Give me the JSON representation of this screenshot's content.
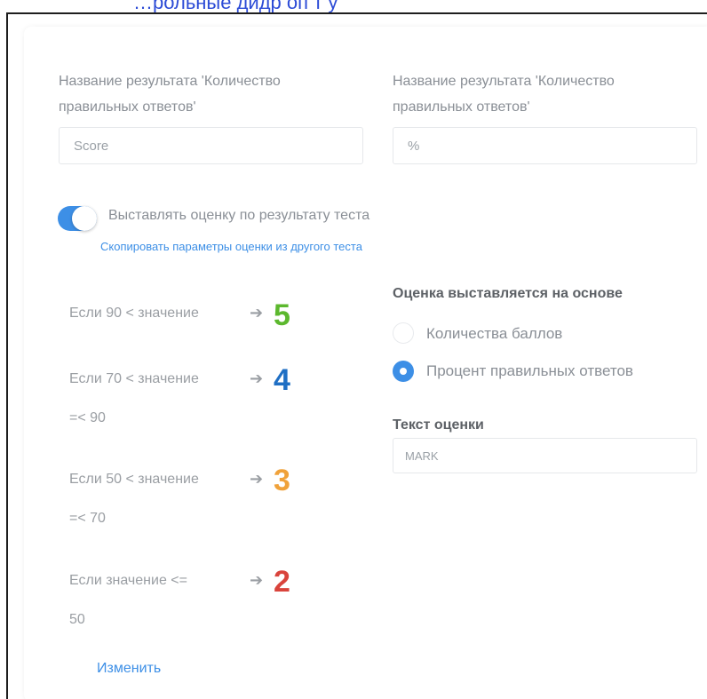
{
  "page_title_partial": "…рольные дидр оп т у",
  "result_name_left": {
    "label": "Название результата 'Количество правильных ответов'",
    "value": "Score"
  },
  "result_name_right": {
    "label": "Название результата 'Количество правильных ответов'",
    "value": "%"
  },
  "grading_toggle": {
    "label": "Выставлять оценку по результату теста",
    "enabled": true
  },
  "copy_link": "Скопировать параметры оценки из другого теста",
  "rules": [
    {
      "line1": "Если 90 < значение",
      "line2": "",
      "grade": "5",
      "color": "#5cb82e"
    },
    {
      "line1": "Если 70 < значение",
      "line2": "=< 90",
      "grade": "4",
      "color": "#1f6fc4"
    },
    {
      "line1": "Если 50 < значение",
      "line2": "=< 70",
      "grade": "3",
      "color": "#f0a23a"
    },
    {
      "line1": "Если значение <=",
      "line2": "50",
      "grade": "2",
      "color": "#d9443c"
    }
  ],
  "basis": {
    "heading": "Оценка выставляется на основе",
    "options": [
      {
        "label": "Количества баллов",
        "selected": false
      },
      {
        "label": "Процент правильных ответов",
        "selected": true
      }
    ]
  },
  "mark_text": {
    "heading": "Текст оценки",
    "value": "MARK"
  },
  "edit_link": "Изменить",
  "colors": {
    "accent": "#3d8fe6",
    "text_muted": "#8a8f96"
  }
}
